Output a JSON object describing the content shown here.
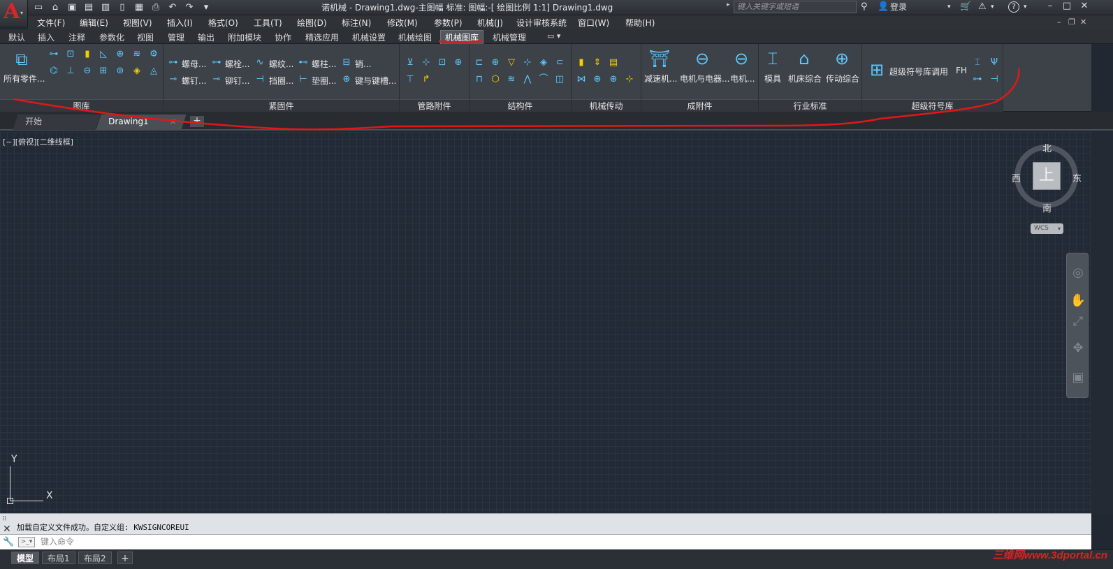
{
  "window": {
    "title": "诺机械 - Drawing1.dwg-主图幅 标准: 图幅:-[ 绘图比例 1:1]      Drawing1.dwg",
    "search_placeholder": "键入关键字或短语",
    "login_label": "登录",
    "help_label": "?"
  },
  "menu": [
    "文件(F)",
    "编辑(E)",
    "视图(V)",
    "插入(I)",
    "格式(O)",
    "工具(T)",
    "绘图(D)",
    "标注(N)",
    "修改(M)",
    "参数(P)",
    "机械(J)",
    "设计审核系统",
    "窗口(W)",
    "帮助(H)"
  ],
  "ribbon_tabs": [
    "默认",
    "插入",
    "注释",
    "参数化",
    "视图",
    "管理",
    "输出",
    "附加模块",
    "协作",
    "精选应用",
    "机械设置",
    "机械绘图",
    "机械图库",
    "机械管理"
  ],
  "active_ribbon_tab": "机械图库",
  "panels": {
    "tuku": {
      "title": "图库",
      "big_label": "所有零件..."
    },
    "jingujian": {
      "title": "紧固件",
      "buttons": [
        "螺母...",
        "螺栓...",
        "螺纹...",
        "螺柱...",
        "销...",
        "螺钉...",
        "铆钉...",
        "挡圈...",
        "垫圈...",
        "键与键槽..."
      ]
    },
    "guandao": {
      "title": "管路附件"
    },
    "jiegou": {
      "title": "结构件"
    },
    "chuandong": {
      "title": "机械传动"
    },
    "chengfujian": {
      "title": "成附件",
      "buttons": [
        "减速机...",
        "电机与电器...",
        "电机..."
      ]
    },
    "hangye": {
      "title": "行业标准",
      "buttons": [
        "模具",
        "机床综合",
        "传动综合"
      ]
    },
    "chaoji": {
      "title": "超级符号库",
      "button": "超级符号库调用",
      "fh": "FH"
    }
  },
  "file_tabs": {
    "start": "开始",
    "drawing": "Drawing1"
  },
  "viewport_label": "[−][俯视][二维线框]",
  "viewcube": {
    "north": "北",
    "south": "南",
    "west": "西",
    "east": "东",
    "face": "上",
    "wcs": "WCS"
  },
  "ucs": {
    "x": "X",
    "y": "Y"
  },
  "command": {
    "history": "加载自定义文件成功。自定义组: KWSIGNCOREUI",
    "placeholder": "键入命令"
  },
  "layout_tabs": [
    "模型",
    "布局1",
    "布局2"
  ],
  "watermark": "三维网www.3dportal.cn",
  "colors": {
    "annotation": "#e01818",
    "icon_blue": "#5cc8ff",
    "icon_yellow": "#f0d000"
  }
}
